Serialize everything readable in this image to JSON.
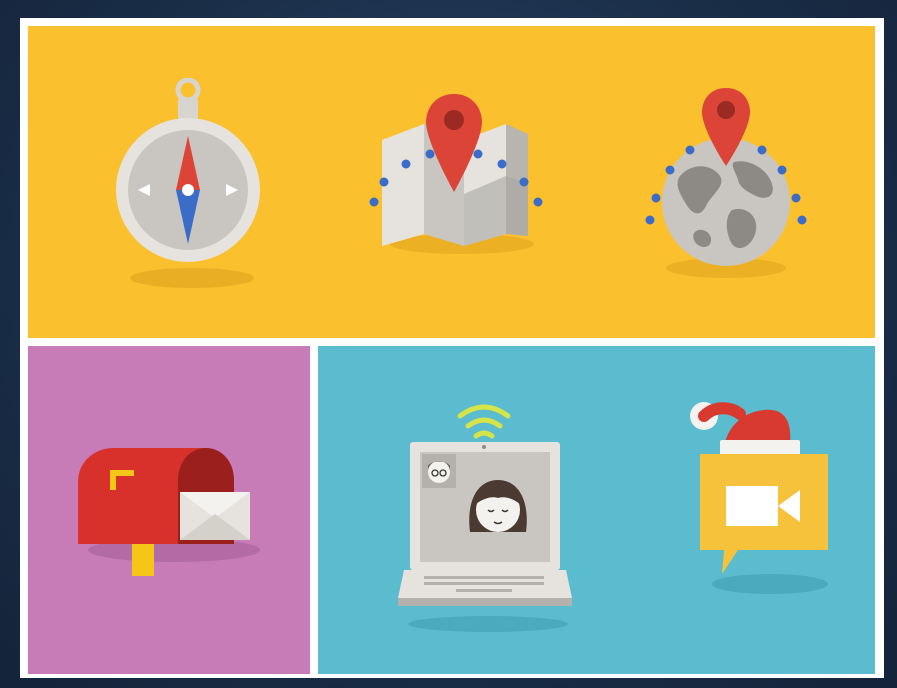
{
  "colors": {
    "frame": "#1d3350",
    "card": "#ffffff",
    "top_panel": "#fbc02d",
    "left_panel": "#c77bb7",
    "right_panel": "#5bbcd0",
    "pin_red": "#db4437",
    "dot_blue": "#3a6cc8",
    "hat_red": "#d93a30",
    "bubble_yellow": "#f7c23b",
    "mailbox_red": "#d8312b",
    "post_yellow": "#f5c518",
    "gray_light": "#e6e3df",
    "gray_mid": "#c9c6c1",
    "gray_dark": "#8d8a86",
    "wifi_green": "#d6e44a"
  },
  "icons": [
    {
      "panel": "top",
      "name": "compass-icon"
    },
    {
      "panel": "top",
      "name": "folded-map-with-pin-icon"
    },
    {
      "panel": "top",
      "name": "globe-with-pin-icon"
    },
    {
      "panel": "left",
      "name": "mailbox-with-letter-icon"
    },
    {
      "panel": "right",
      "name": "laptop-video-chat-icon"
    },
    {
      "panel": "right",
      "name": "video-chat-santa-hat-icon"
    }
  ]
}
